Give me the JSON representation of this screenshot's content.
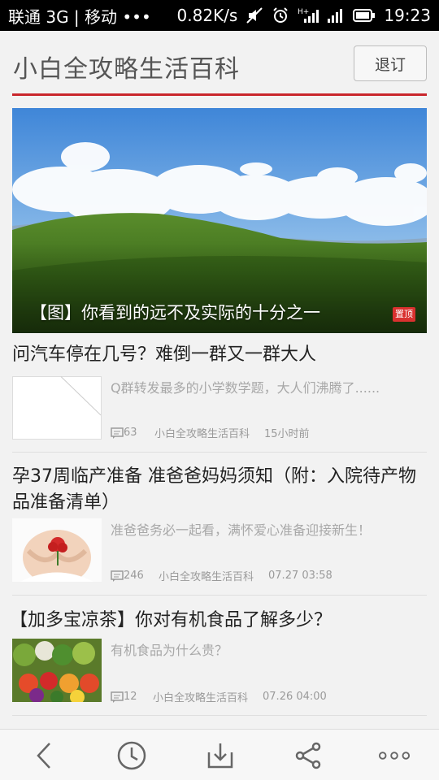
{
  "status_bar": {
    "carrier": "联通 3G | 移动 •••",
    "speed": "0.82K/s",
    "time": "19:23",
    "network_label": "H+"
  },
  "header": {
    "title": "小白全攻略生活百科",
    "subscribe_label": "退订"
  },
  "banner": {
    "caption": "【图】你看到的远不及实际的十分之一",
    "pin_badge": "置顶"
  },
  "articles": [
    {
      "title": "问汽车停在几号？难倒一群又一群大人",
      "desc": "Q群转发最多的小学数学题，大人们沸腾了......",
      "comments": "63",
      "source": "小白全攻略生活百科",
      "time": "15小时前",
      "thumb": "blank-image"
    },
    {
      "title": "孕37周临产准备 准爸爸妈妈须知（附：入院待产物品准备清单）",
      "desc": "准爸爸务必一起看，满怀爱心准备迎接新生！",
      "comments": "246",
      "source": "小白全攻略生活百科",
      "time": "07.27 03:58",
      "thumb": "pregnant-belly-with-flower"
    },
    {
      "title": "【加多宝凉茶】你对有机食品了解多少？",
      "desc": "有机食品为什么贵？",
      "comments": "12",
      "source": "小白全攻略生活百科",
      "time": "07.26 04:00",
      "thumb": "vegetables"
    }
  ],
  "bottom_bar": {
    "icons": [
      "back-icon",
      "history-icon",
      "download-icon",
      "share-icon",
      "more-icon"
    ]
  },
  "colors": {
    "accent": "#c9262c",
    "badge": "#d9312f",
    "meta_text": "#9a9a9a"
  }
}
